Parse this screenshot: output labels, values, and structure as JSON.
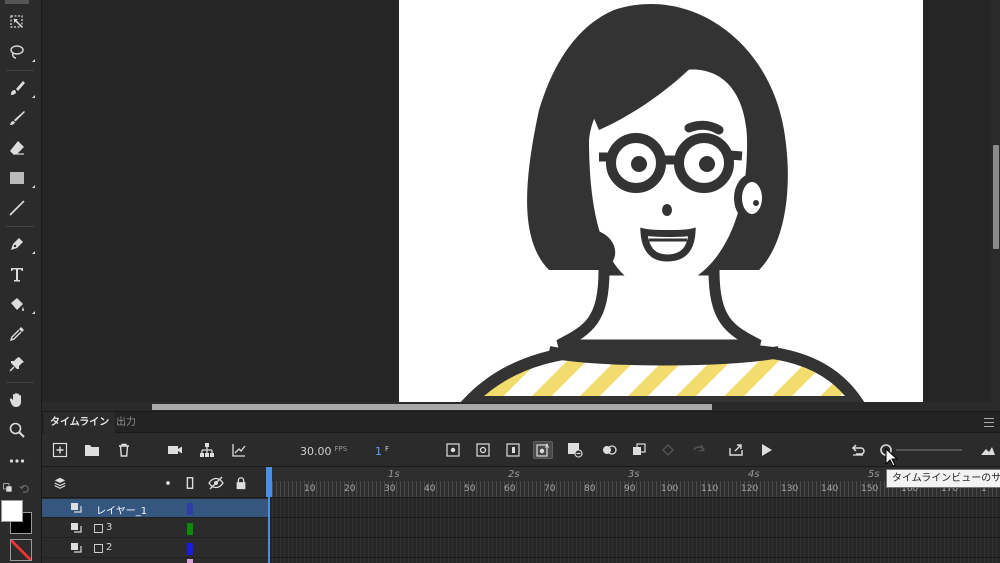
{
  "timeline": {
    "tab_active": "タイムライン",
    "tab_inactive": "出力",
    "fps_value": "30.00",
    "fps_unit": "FPS",
    "frame_value": "1",
    "frame_unit": "F",
    "seconds": [
      "1s",
      "2s",
      "3s",
      "4s",
      "5s"
    ],
    "frame_numbers": [
      "10",
      "20",
      "30",
      "40",
      "50",
      "60",
      "70",
      "80",
      "90",
      "100",
      "110",
      "120",
      "130",
      "140",
      "150",
      "160",
      "170",
      "1"
    ],
    "tooltip": "タイムラインビューのサイズ"
  },
  "layers": [
    {
      "name": "レイヤー_1",
      "color": "#2f3fa8",
      "selected": true
    },
    {
      "name": "3",
      "color": "#0a8a0a",
      "selected": false
    },
    {
      "name": "2",
      "color": "#1a1ae0",
      "selected": false
    }
  ],
  "icons": {
    "tools": [
      "free-transform-icon",
      "lasso-icon",
      "paint-brush-icon",
      "brush-icon",
      "eraser-icon",
      "rectangle-icon",
      "line-icon",
      "pen-icon",
      "text-icon",
      "paint-bucket-icon",
      "eyedropper-icon",
      "pin-icon",
      "hand-icon",
      "zoom-icon",
      "more-icon"
    ]
  },
  "colors": {
    "accent": "#4a90e2",
    "selected_layer": "#35567f",
    "stripe": "#f2dc6e",
    "character": "#333333"
  }
}
